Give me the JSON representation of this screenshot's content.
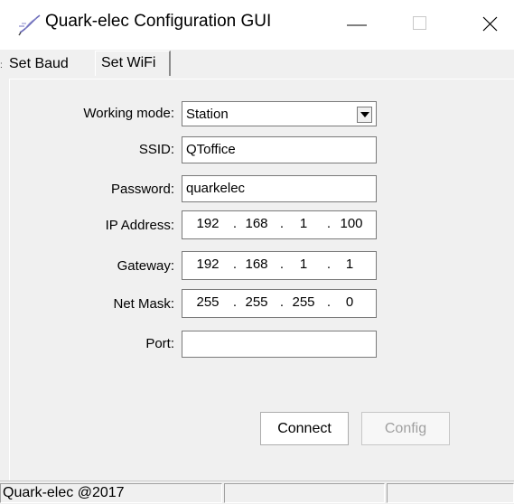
{
  "window": {
    "title": "Quark-elec Configuration GUI",
    "icon": "feather-pen-icon"
  },
  "tabs": [
    {
      "label": "Set Baud",
      "active": false
    },
    {
      "label": "Set WiFi",
      "active": true
    }
  ],
  "form": {
    "working_mode": {
      "label": "Working mode:",
      "value": "Station"
    },
    "ssid": {
      "label": "SSID:",
      "value": "QToffice"
    },
    "password": {
      "label": "Password:",
      "value": "quarkelec"
    },
    "ip_address": {
      "label": "IP Address:",
      "octets": [
        "192",
        "168",
        "1",
        "100"
      ]
    },
    "gateway": {
      "label": "Gateway:",
      "octets": [
        "192",
        "168",
        "1",
        "1"
      ]
    },
    "net_mask": {
      "label": "Net Mask:",
      "octets": [
        "255",
        "255",
        "255",
        "0"
      ]
    },
    "port": {
      "label": "Port:",
      "value": ""
    }
  },
  "buttons": {
    "connect": "Connect",
    "config": "Config"
  },
  "status_bar": {
    "text": "Quark-elec @2017"
  }
}
